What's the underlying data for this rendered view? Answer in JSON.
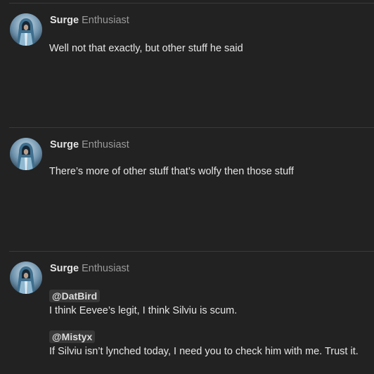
{
  "posts": [
    {
      "username": "Surge",
      "user_title": "Enthusiast",
      "avatar_icon": "hooded-figure-avatar",
      "lines": [
        "Well not that exactly, but other stuff he said"
      ]
    },
    {
      "username": "Surge",
      "user_title": "Enthusiast",
      "avatar_icon": "hooded-figure-avatar",
      "lines": [
        "There’s more of other stuff that’s wolfy then those stuff"
      ]
    },
    {
      "username": "Surge",
      "user_title": "Enthusiast",
      "avatar_icon": "hooded-figure-avatar",
      "mention_1": "@DatBird",
      "line_1": "I think Eevee’s legit, I think Silviu is scum.",
      "mention_2": "@Mistyx",
      "line_2": "If Silviu isn’t lynched today, I need you to check him with me. Trust it."
    }
  ]
}
